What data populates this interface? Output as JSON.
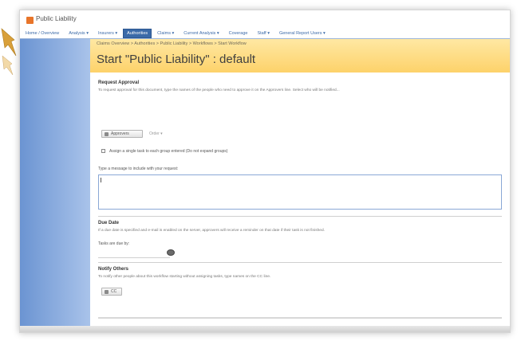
{
  "app": {
    "title": "Public Liability"
  },
  "topnav": {
    "tabs": [
      {
        "label": "Home / Overview"
      },
      {
        "label": "Analysis ▾"
      },
      {
        "label": "Insurers ▾"
      },
      {
        "label": "Authorities"
      },
      {
        "label": "Claims ▾"
      },
      {
        "label": "Current Analysis ▾"
      },
      {
        "label": "Coverage"
      },
      {
        "label": "Staff ▾"
      },
      {
        "label": "General Report Users ▾"
      }
    ]
  },
  "header": {
    "breadcrumb": "Claims Overview > Authorities > Public Liability > Workflows > Start Workflow",
    "page_title": "Start \"Public Liability\" : default"
  },
  "form": {
    "request_approval_heading": "Request Approval",
    "request_approval_desc": "To request approval for this document, type the names of the people who need to approve it on the Approvers line. Select who will be notified...",
    "approvers_button_label": "Approvers",
    "approvers_link": "Order ▾",
    "checkbox_label": "Assign a single task to each group entered (Do not expand groups)",
    "message_label": "Type a message to include with your request:",
    "due_date_heading": "Due Date",
    "due_date_desc": "If a due date is specified and e-mail is enabled on the server, approvers will receive a reminder on that date if their task is not finished.",
    "due_date_field_label": "Tasks are due by:",
    "notify_heading": "Notify Others",
    "notify_desc": "To notify other people about this workflow starting without assigning tasks, type names on the CC line.",
    "cc_button_label": "CC"
  }
}
